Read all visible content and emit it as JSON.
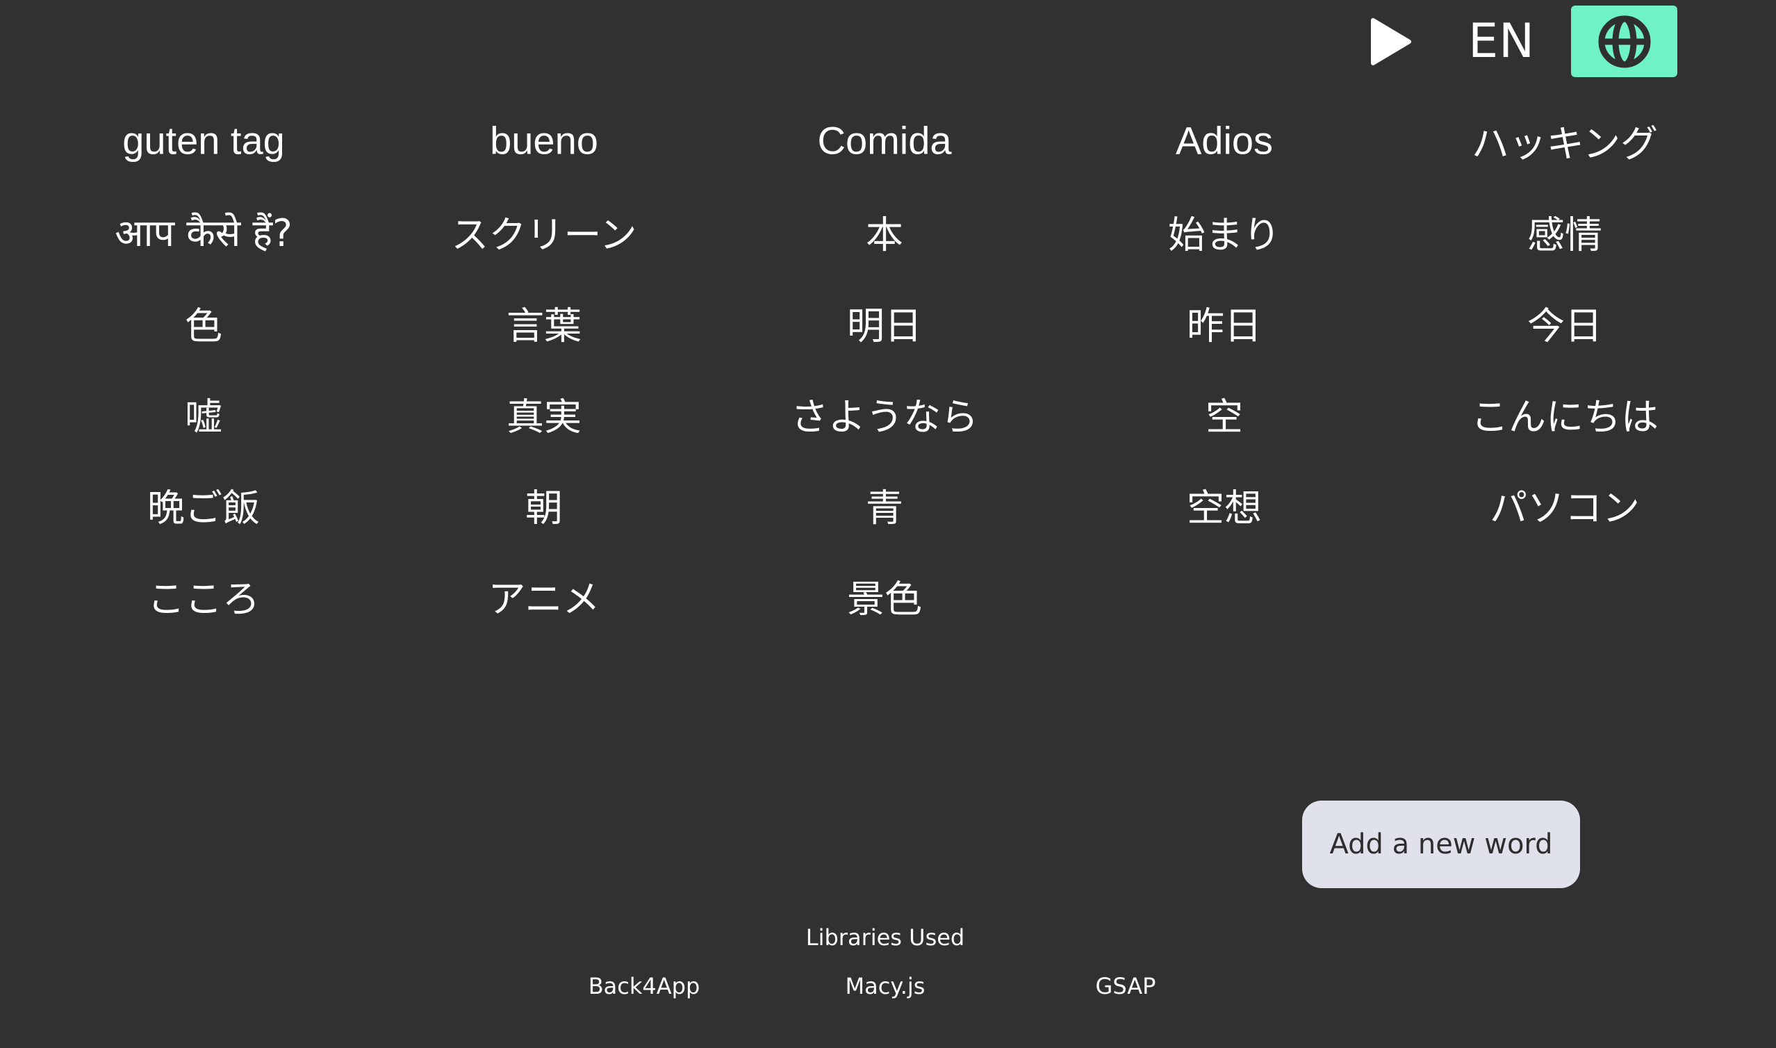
{
  "header": {
    "language_code": "EN",
    "play_icon": "play-icon",
    "globe_icon": "globe-icon",
    "globe_button_color": "#6ff3c6"
  },
  "words": [
    [
      "guten tag",
      "bueno",
      "Comida",
      "Adios",
      "ハッキング"
    ],
    [
      "आप कैसे हैं?",
      "スクリーン",
      "本",
      "始まり",
      "感情"
    ],
    [
      "色",
      "言葉",
      "明日",
      "昨日",
      "今日"
    ],
    [
      "嘘",
      "真実",
      "さようなら",
      "空",
      "こんにちは"
    ],
    [
      "晩ご飯",
      "朝",
      "青",
      "空想",
      "パソコン"
    ],
    [
      "こころ",
      "アニメ",
      "景色"
    ]
  ],
  "add_button": {
    "label": "Add a new word"
  },
  "footer": {
    "title": "Libraries Used",
    "libraries": [
      "Back4App",
      "Macy.js",
      "GSAP"
    ]
  },
  "colors": {
    "background": "#313131",
    "text": "#ffffff",
    "accent": "#6ff3c6",
    "button_bg": "#dfe2ea"
  }
}
